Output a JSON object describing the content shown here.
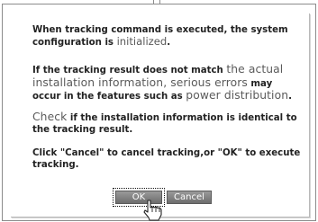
{
  "dialog": {
    "para1": {
      "a": "When tracking command is executed, the system configuration is ",
      "b": "initialized",
      "c": "."
    },
    "para2": {
      "a": "If the tracking result does not match ",
      "b": "the actual installation information",
      "c": ", ",
      "d": "serious errors",
      "e": " may occur in the features such as ",
      "f": "power distribution",
      "g": "."
    },
    "para3": {
      "a": "Check",
      "b": " if the installation information is identical to the tracking result."
    },
    "para4": "Click \"Cancel\" to cancel tracking,or \"OK\" to execute tracking.",
    "ok_label": "OK",
    "cancel_label": "Cancel"
  },
  "icons": {
    "cursor": "hand-pointer-icon"
  }
}
